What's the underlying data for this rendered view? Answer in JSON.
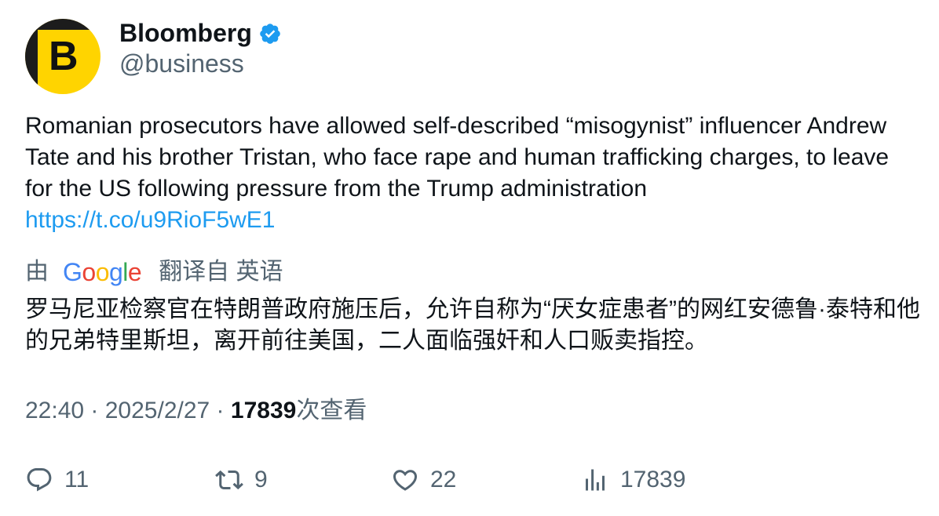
{
  "account": {
    "display_name": "Bloomberg",
    "handle": "@business",
    "avatar_letter": "B",
    "avatar_color": "#ffd400",
    "verified_color": "#1d9bf0",
    "verified_icon": "verified-badge-icon"
  },
  "tweet": {
    "text": "Romanian prosecutors have allowed self-described “misogynist” influencer Andrew Tate and his brother Tristan, who face rape and human trafficking charges, to leave for the US following pressure from the Trump administration",
    "link": "https://t.co/u9RioF5wE1",
    "link_color": "#1d9bf0"
  },
  "translation": {
    "prefix": "由",
    "provider": "Google",
    "label": "翻译自 英语",
    "text": "罗马尼亚检察官在特朗普政府施压后，允许自称为“厌女症患者”的网红安德鲁·泰特和他的兄弟特里斯坦，离开前往美国，二人面临强奸和人口贩卖指控。"
  },
  "meta": {
    "time": "22:40",
    "separator": " · ",
    "date": "2025/2/27",
    "views_count": "17839",
    "views_label": "次查看"
  },
  "actions": {
    "replies": {
      "icon": "reply-icon",
      "count": "11"
    },
    "retweets": {
      "icon": "retweet-icon",
      "count": "9"
    },
    "likes": {
      "icon": "heart-icon",
      "count": "22"
    },
    "views": {
      "icon": "analytics-icon",
      "count": "17839"
    }
  },
  "colors": {
    "text_primary": "#0f1419",
    "text_secondary": "#536471"
  }
}
